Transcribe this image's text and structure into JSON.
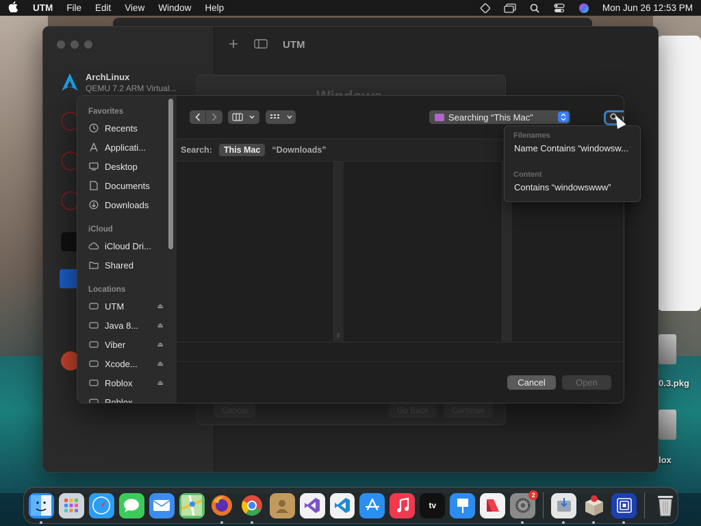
{
  "menubar": {
    "app_name": "UTM",
    "items": [
      "File",
      "Edit",
      "View",
      "Window",
      "Help"
    ],
    "datetime": "Mon Jun 26  12:53 PM",
    "icons": [
      "apple-logo-icon",
      "diamond-icon",
      "window-stack-icon",
      "search-icon",
      "control-center-icon",
      "siri-icon"
    ]
  },
  "utm_window": {
    "title": "UTM",
    "vm": {
      "name": "ArchLinux",
      "subtitle": "QEMU 7.2 ARM Virtual..."
    },
    "ghost_dialog": {
      "title": "Windows",
      "buttons": [
        "Cancel",
        "Go Back",
        "Continue"
      ]
    }
  },
  "open_panel": {
    "sidebar": {
      "favorites_header": "Favorites",
      "favorites": [
        {
          "label": "Recents",
          "icon": "clock-icon"
        },
        {
          "label": "Applicati...",
          "icon": "applications-icon"
        },
        {
          "label": "Desktop",
          "icon": "desktop-icon"
        },
        {
          "label": "Documents",
          "icon": "document-icon"
        },
        {
          "label": "Downloads",
          "icon": "download-icon"
        }
      ],
      "icloud_header": "iCloud",
      "icloud": [
        {
          "label": "iCloud Dri...",
          "icon": "cloud-icon"
        },
        {
          "label": "Shared",
          "icon": "shared-folder-icon"
        }
      ],
      "locations_header": "Locations",
      "locations": [
        {
          "label": "UTM",
          "icon": "drive-icon"
        },
        {
          "label": "Java 8...",
          "icon": "drive-icon"
        },
        {
          "label": "Viber",
          "icon": "drive-icon"
        },
        {
          "label": "Xcode...",
          "icon": "drive-icon"
        },
        {
          "label": "Roblox",
          "icon": "drive-icon"
        },
        {
          "label": "Roblox",
          "icon": "drive-icon"
        }
      ]
    },
    "location_popup": "Searching “This Mac”",
    "search_value": "windowswww",
    "scope": {
      "label": "Search:",
      "this_mac": "This Mac",
      "downloads": "“Downloads”"
    },
    "buttons": {
      "cancel": "Cancel",
      "open": "Open"
    }
  },
  "suggestions": {
    "filenames_header": "Filenames",
    "filename_item": "Name Contains “windowsw...",
    "content_header": "Content",
    "content_item": "Contains “windowswww”"
  },
  "desktop": {
    "files": [
      "0.3.pkg",
      "lox"
    ]
  },
  "dock": {
    "apps": [
      {
        "name": "Finder",
        "color": "#2a8cf0"
      },
      {
        "name": "Launchpad",
        "color": "#d0d4dc"
      },
      {
        "name": "Safari",
        "color": "#2a9df4"
      },
      {
        "name": "Messages",
        "color": "#3ccb5a"
      },
      {
        "name": "Mail",
        "color": "#3b8ef0"
      },
      {
        "name": "Maps",
        "color": "#5fbf6a"
      },
      {
        "name": "Firefox",
        "color": "#e8752a"
      },
      {
        "name": "Chrome",
        "color": "#e04a3a"
      },
      {
        "name": "Contacts",
        "color": "#c29a5e"
      },
      {
        "name": "Visual Studio",
        "color": "#7a55c9"
      },
      {
        "name": "VS Code",
        "color": "#1f8ad2"
      },
      {
        "name": "App Store",
        "color": "#2a8ff0"
      },
      {
        "name": "Music",
        "color": "#f0384f"
      },
      {
        "name": "Apple TV",
        "color": "#111111"
      },
      {
        "name": "Keynote",
        "color": "#2d8cf0"
      },
      {
        "name": "News",
        "color": "#f2f2f2"
      },
      {
        "name": "System Settings",
        "color": "#8a8a8a"
      }
    ],
    "tv_label": "tv",
    "settings_badge": "2"
  }
}
